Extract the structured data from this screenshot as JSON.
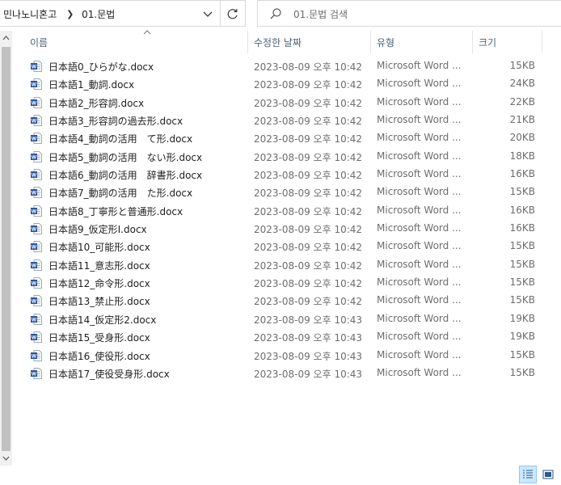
{
  "address": {
    "crumbs": [
      "민나노니혼고",
      "01.문법"
    ]
  },
  "search": {
    "placeholder": "01.문법 검색"
  },
  "columns": {
    "name": "이름",
    "date": "수정한 날짜",
    "type": "유형",
    "size": "크기"
  },
  "files": [
    {
      "name": "日本語0_ひらがな.docx",
      "date": "2023-08-09 오후 10:42",
      "type": "Microsoft Word ...",
      "size": "15KB"
    },
    {
      "name": "日本語1_動詞.docx",
      "date": "2023-08-09 오후 10:42",
      "type": "Microsoft Word ...",
      "size": "24KB"
    },
    {
      "name": "日本語2_形容詞.docx",
      "date": "2023-08-09 오후 10:42",
      "type": "Microsoft Word ...",
      "size": "22KB"
    },
    {
      "name": "日本語3_形容詞の過去形.docx",
      "date": "2023-08-09 오후 10:42",
      "type": "Microsoft Word ...",
      "size": "21KB"
    },
    {
      "name": "日本語4_動詞の活用　て形.docx",
      "date": "2023-08-09 오후 10:42",
      "type": "Microsoft Word ...",
      "size": "20KB"
    },
    {
      "name": "日本語5_動詞の活用　ない形.docx",
      "date": "2023-08-09 오후 10:42",
      "type": "Microsoft Word ...",
      "size": "18KB"
    },
    {
      "name": "日本語6_動詞の活用　辞書形.docx",
      "date": "2023-08-09 오후 10:42",
      "type": "Microsoft Word ...",
      "size": "16KB"
    },
    {
      "name": "日本語7_動詞の活用　た形.docx",
      "date": "2023-08-09 오후 10:42",
      "type": "Microsoft Word ...",
      "size": "15KB"
    },
    {
      "name": "日本語8_丁寧形と普通形.docx",
      "date": "2023-08-09 오후 10:42",
      "type": "Microsoft Word ...",
      "size": "16KB"
    },
    {
      "name": "日本語9_仮定形Ⅰ.docx",
      "date": "2023-08-09 오후 10:42",
      "type": "Microsoft Word ...",
      "size": "16KB"
    },
    {
      "name": "日本語10_可能形.docx",
      "date": "2023-08-09 오후 10:42",
      "type": "Microsoft Word ...",
      "size": "15KB"
    },
    {
      "name": "日本語11_意志形.docx",
      "date": "2023-08-09 오후 10:42",
      "type": "Microsoft Word ...",
      "size": "15KB"
    },
    {
      "name": "日本語12_命令形.docx",
      "date": "2023-08-09 오후 10:42",
      "type": "Microsoft Word ...",
      "size": "15KB"
    },
    {
      "name": "日本語13_禁止形.docx",
      "date": "2023-08-09 오후 10:42",
      "type": "Microsoft Word ...",
      "size": "15KB"
    },
    {
      "name": "日本語14_仮定形2.docx",
      "date": "2023-08-09 오후 10:43",
      "type": "Microsoft Word ...",
      "size": "19KB"
    },
    {
      "name": "日本語15_受身形.docx",
      "date": "2023-08-09 오후 10:43",
      "type": "Microsoft Word ...",
      "size": "19KB"
    },
    {
      "name": "日本語16_使役形.docx",
      "date": "2023-08-09 오후 10:43",
      "type": "Microsoft Word ...",
      "size": "15KB"
    },
    {
      "name": "日本語17_使役受身形.docx",
      "date": "2023-08-09 오후 10:43",
      "type": "Microsoft Word ...",
      "size": "15KB"
    }
  ],
  "icons": {
    "file": "word-document-icon",
    "search": "search-icon",
    "refresh": "refresh-icon",
    "dropdown": "chevron-down-icon",
    "sort": "sort-up-arrow-icon"
  },
  "colors": {
    "word_blue": "#2b579a",
    "header_text": "#4c607a",
    "muted_text": "#6d6d6d",
    "selected_view": "#cce8ff"
  }
}
